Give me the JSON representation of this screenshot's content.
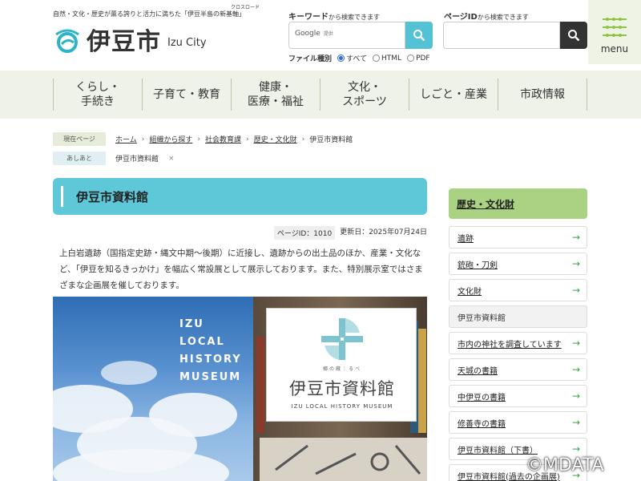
{
  "header": {
    "tagline": "自然・文化・歴史が薫る誇りと活力に満ちた「伊豆半島の新基軸」",
    "tagline_ruby": "クロスロード",
    "logo_jp": "伊豆市",
    "logo_en": "Izu City",
    "keyword": {
      "label": "キーワード",
      "note": "から検索できます",
      "placeholder": "Google",
      "provider": "提供"
    },
    "page_id": {
      "label": "ページID",
      "note": "から検索できます",
      "value": ""
    },
    "filetype": {
      "label": "ファイル種別",
      "options": [
        "すべて",
        "HTML",
        "PDF"
      ],
      "selected": "すべて"
    },
    "menu_label": "menu"
  },
  "gnav": [
    "くらし・\n手続き",
    "子育て・教育",
    "健康・\n医療・福祉",
    "文化・\nスポーツ",
    "しごと・産業",
    "市政情報"
  ],
  "breadcrumb": {
    "tag": "現在ページ",
    "items": [
      "ホーム",
      "組織から探す",
      "社会教育課",
      "歴史・文化財"
    ],
    "current": "伊豆市資料館"
  },
  "trail": {
    "tag": "あしあと",
    "items": [
      "伊豆市資料館"
    ],
    "remove": "×"
  },
  "main": {
    "title": "伊豆市資料館",
    "page_id": "ページID：1010",
    "updated": "更新日：2025年07月24日",
    "lead": "上白岩遺跡（国指定史跡・縄文中期～後期）に近接し、遺跡からの出土品のほか、産業・文化など、「伊豆を知るきっかけ」を幅広く常設展として展示しております。また、特別展示室ではさまざまな企画展を催しております。",
    "hero": {
      "en_text": "IZU\nLOCAL\nHISTORY\nMUSEUM",
      "card_ruby": "郷の蔵｜るべ",
      "card_jp": "伊豆市資料館",
      "card_en": "IZU LOCAL HISTORY MUSEUM"
    }
  },
  "sidebar": {
    "heading": "歴史・文化財",
    "items": [
      {
        "label": "遺跡",
        "current": false
      },
      {
        "label": "銃砲・刀剣",
        "current": false
      },
      {
        "label": "文化財",
        "current": false
      },
      {
        "label": "伊豆市資料館",
        "current": true
      },
      {
        "label": "市内の神社を調査しています",
        "current": false
      },
      {
        "label": "天城の書籍",
        "current": false
      },
      {
        "label": "中伊豆の書籍",
        "current": false
      },
      {
        "label": "修善寺の書籍",
        "current": false
      },
      {
        "label": "伊豆市資料館（下書）",
        "current": false
      },
      {
        "label": "伊豆市資料館(過去の企画展)",
        "current": false
      }
    ]
  },
  "watermark": "©MDATA",
  "colors": {
    "accent": "#5ec8d8",
    "nav_bg": "#eef2e8",
    "side_head": "#a9d283",
    "dark_btn": "#333333"
  }
}
